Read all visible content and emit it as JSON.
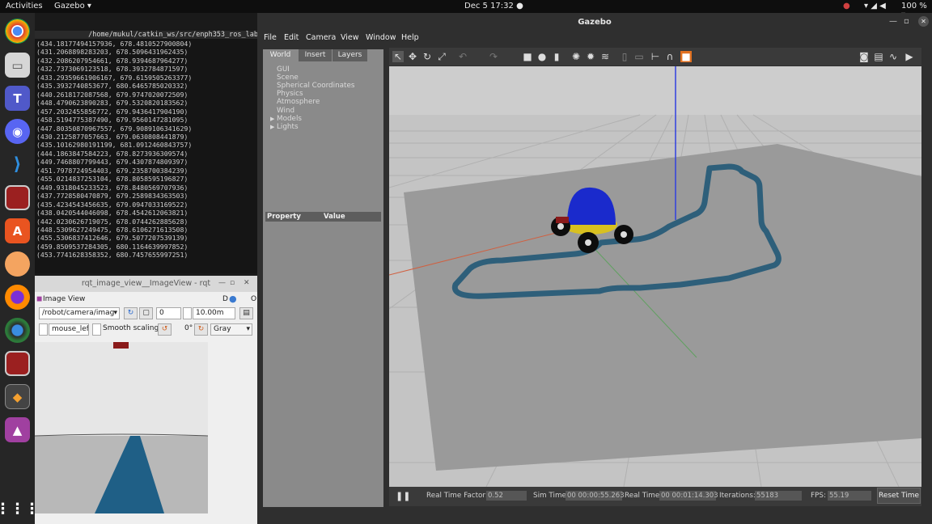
{
  "topbar": {
    "activities": "Activities",
    "app_menu": "Gazebo ▾",
    "clock": "Dec 5  17:32  ●",
    "battery": "100 % ▾"
  },
  "dock": {
    "items": [
      "chrome-icon",
      "files-icon",
      "teams-icon",
      "discord-icon",
      "vscode-icon",
      "terminal-icon",
      "software-icon",
      "mango-icon",
      "firefox-icon",
      "browser-icon",
      "terminal2-icon",
      "gazebo-icon",
      "image-viewer-icon",
      "apps-grid-icon"
    ]
  },
  "terminal": {
    "title": "/home/mukul/catkin_ws/src/enph353_ros_lab",
    "lines": [
      "(434.18177494157936, 678.4810527900804)",
      "(431.2068898283203, 678.5096431962435)",
      "(432.2086207954661, 678.9394687964277)",
      "(432.7373069123518, 678.3932784871597)",
      "(433.29359661906167, 679.6159505263377)",
      "(435.3932740853677, 680.6465785020332)",
      "(440.2618172087568, 679.9747020072509)",
      "(448.4790623890283, 679.5320820183562)",
      "(457.2032455856772, 679.9436417904190)",
      "(458.5194775387490, 679.9560147281095)",
      "(447.80350870967557, 679.9089106341629)",
      "(430.2125877057663, 679.0630808441879)",
      "(435.10162980191199, 681.0912460843757)",
      "(444.1863847584223, 678.8273936309574)",
      "(449.7468807799443, 679.4307874809397)",
      "(451.7978724954403, 679.2358700384239)",
      "(455.0214837253104, 678.8058595196827)",
      "(449.9318045233523, 678.8480569707936)",
      "(437.7728580470879, 679.2589834363503)",
      "(435.4234543456635, 679.0947033169522)",
      "(438.0420544046098, 678.4542612063821)",
      "(442.0230626719075, 678.0744262885628)",
      "(448.5309627249475, 678.6106271613508)",
      "(455.5306837412646, 679.5077207539139)",
      "(459.8509537284305, 680.1164639997852)",
      "(453.7741628358352, 680.7457655997251)"
    ]
  },
  "rqt": {
    "title": "rqt_image_view__ImageView - rqt",
    "panel_label": "Image View",
    "corner_label": "D",
    "corner_label2": "O",
    "topic": "/robot/camera/imag",
    "spin_value": "0",
    "max_range": "10.00m",
    "mouse_field": "mouse_left",
    "smooth_label": "Smooth scaling",
    "rotation": "0°",
    "colormap": "Gray"
  },
  "gazebo": {
    "title": "Gazebo",
    "menus": [
      "File",
      "Edit",
      "Camera",
      "View",
      "Window",
      "Help"
    ],
    "tabs": [
      "World",
      "Insert",
      "Layers"
    ],
    "tree": [
      "GUI",
      "Scene",
      "Spherical Coordinates",
      "Physics",
      "Atmosphere",
      "Wind",
      "Models",
      "Lights"
    ],
    "prop_header": [
      "Property",
      "Value"
    ],
    "status": {
      "rtf_label": "Real Time Factor:",
      "rtf_value": "0.52",
      "sim_label": "Sim Time:",
      "sim_value": "00 00:00:55.263",
      "real_label": "Real Time:",
      "real_value": "00 00:01:14.303",
      "iter_label": "Iterations:",
      "iter_value": "55183",
      "fps_label": "FPS:",
      "fps_value": "55.19",
      "reset_label": "Reset Time"
    }
  }
}
